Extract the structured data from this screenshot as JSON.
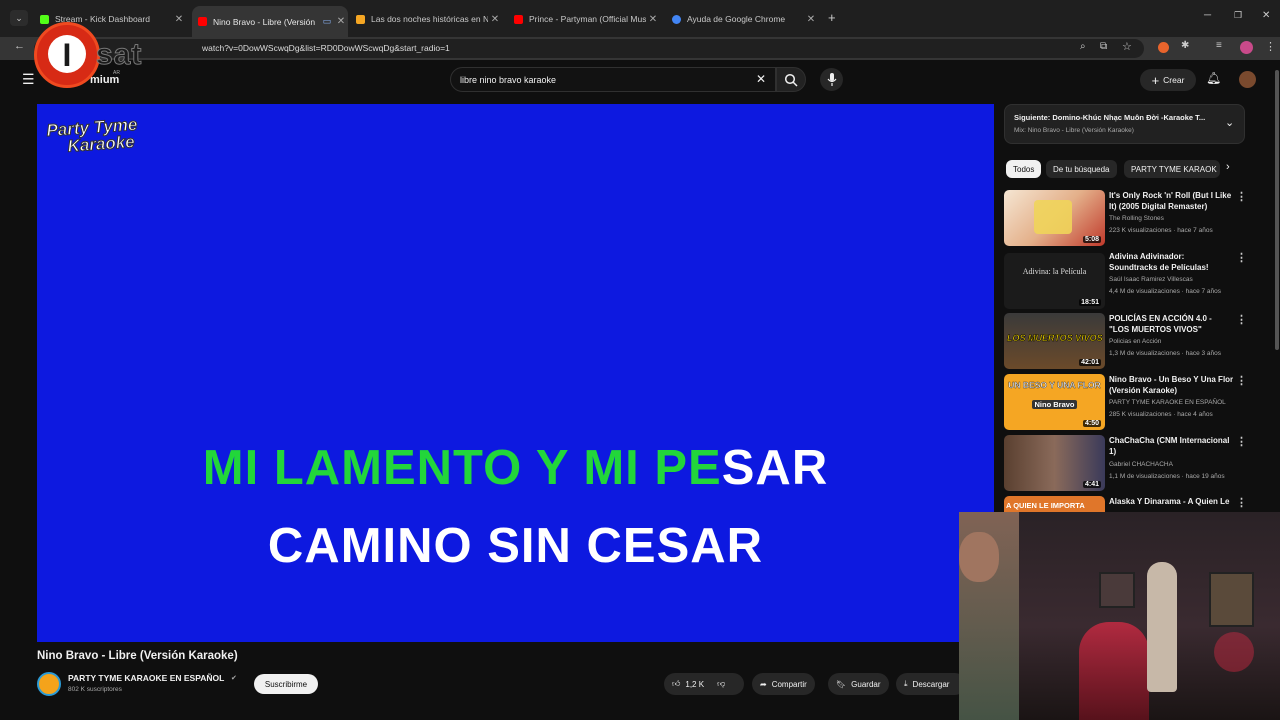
{
  "browser": {
    "tabs": [
      {
        "title": "Stream - Kick Dashboard",
        "color": "#53fc18"
      },
      {
        "title": "Nino Bravo - Libre (Versión",
        "color": "#ff0000"
      },
      {
        "title": "Las dos noches históricas en N",
        "color": "#f5a623"
      },
      {
        "title": "Prince - Partyman (Official Mus",
        "color": "#ff0000"
      },
      {
        "title": "Ayuda de Google Chrome",
        "color": "#4285f4"
      }
    ],
    "url": "watch?v=0DowWScwqDg&list=RD0DowWScwqDg&start_radio=1"
  },
  "overlay_logo": {
    "letter": "I",
    "text": "sat"
  },
  "youtube": {
    "logo_text": "mium",
    "logo_badge": "AR",
    "search_value": "libre nino bravo karaoke",
    "create_label": "Crear",
    "video_title": "Nino Bravo - Libre (Versión Karaoke)",
    "channel_name": "PARTY TYME KARAOKE EN ESPAÑOL",
    "subscribers": "802 K suscriptores",
    "subscribe_label": "Suscribirme",
    "like_count": "1,2 K",
    "share_label": "Compartir",
    "save_label": "Guardar",
    "download_label": "Descargar",
    "player_brand_1": "Party Tyme",
    "player_brand_2": "Karaoke",
    "lyric_line1_sung": "MI LAMENTO Y MI PE",
    "lyric_line1_rest": "SAR",
    "lyric_line2": "CAMINO SIN CESAR",
    "sung_color": "#22d63a",
    "player_bg": "#0d19e0"
  },
  "playlist": {
    "next_label": "Siguiente: Domino-Khúc Nhạc Muôn Đời -Karaoke T...",
    "mix_label": "Mix: Nino Bravo - Libre (Versión Karaoke)"
  },
  "chips": [
    "Todos",
    "De tu búsqueda",
    "PARTY TYME KARAOK"
  ],
  "related": [
    {
      "title": "It's Only Rock 'n' Roll (But I Like It) (2005 Digital Remaster)",
      "channel": "The Rolling Stones",
      "stats": "223 K visualizaciones · hace 7 años",
      "duration": "5:08"
    },
    {
      "title": "Adivina Adivinador: Soundtracks de Películas!",
      "channel": "Saúl Isaac Ramirez Villescas",
      "stats": "4,4 M de visualizaciones · hace 7 años",
      "duration": "18:51",
      "thumb_text": "Adivina: la Película"
    },
    {
      "title": "POLICÍAS EN ACCIÓN 4.0 - \"LOS MUERTOS VIVOS\"",
      "channel": "Policias en Acción",
      "stats": "1,3 M de visualizaciones · hace 3 años",
      "duration": "42:01",
      "thumb_text": "LOS MUERTOS VIVOS"
    },
    {
      "title": "Nino Bravo - Un Beso Y Una Flor (Versión Karaoke)",
      "channel": "PARTY TYME KARAOKE EN ESPAÑOL",
      "stats": "285 K visualizaciones · hace 4 años",
      "duration": "4:50",
      "thumb_text": "UN BESO Y UNA FLOR",
      "thumb_sub": "Nino Bravo"
    },
    {
      "title": "ChaChaCha (CNM Internacional 1)",
      "channel": "Gabriel CHACHACHA",
      "stats": "1,1 M de visualizaciones · hace 19 años",
      "duration": "4:41"
    },
    {
      "title": "Alaska Y Dinarama - A Quien Le",
      "thumb_text": "A QUIEN LE IMPORTA"
    }
  ]
}
